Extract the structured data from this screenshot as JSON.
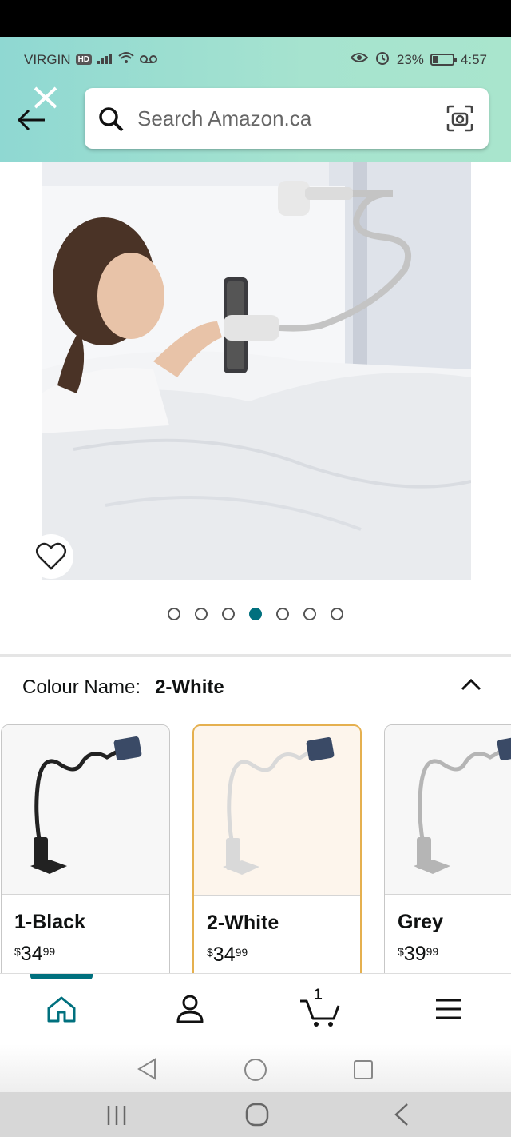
{
  "status_bar": {
    "carrier": "VIRGIN",
    "network_badge": "HD",
    "battery_percent": "23%",
    "battery_level": 0.23,
    "time": "4:57",
    "icons": [
      "signal-icon",
      "wifi-icon",
      "voicemail-icon",
      "eye-icon",
      "alarm-icon",
      "battery-icon"
    ]
  },
  "header": {
    "back_icon": "arrow-left-icon",
    "close_icon": "close-icon",
    "search": {
      "placeholder": "Search Amazon.ca",
      "value": "",
      "search_icon": "search-icon",
      "camera_icon": "camera-scan-icon"
    },
    "gradient_colors": [
      "#8fd8d2",
      "#a9e5cd"
    ]
  },
  "gallery": {
    "wishlist_icon": "heart-icon",
    "image_count": 7,
    "active_index": 3
  },
  "variation": {
    "label": "Colour Name:",
    "selected_value": "2-White",
    "toggle_icon": "chevron-up-icon",
    "options": [
      {
        "name": "1-Black",
        "currency": "$",
        "price_whole": "34",
        "price_cents": "99",
        "stand_color": "#222222",
        "selected": false
      },
      {
        "name": "2-White",
        "currency": "$",
        "price_whole": "34",
        "price_cents": "99",
        "stand_color": "#d9d9d9",
        "selected": true
      },
      {
        "name": "Grey",
        "currency": "$",
        "price_whole": "39",
        "price_cents": "99",
        "stand_color": "#b5b5b5",
        "selected": false
      }
    ]
  },
  "bottom_nav": {
    "items": [
      {
        "icon": "home-icon",
        "active": true
      },
      {
        "icon": "account-icon",
        "active": false
      },
      {
        "icon": "cart-icon",
        "active": false,
        "count": "1"
      },
      {
        "icon": "menu-icon",
        "active": false
      }
    ],
    "accent_color": "#00707e"
  },
  "system_nav": {
    "row1": [
      "back-triangle-icon",
      "home-circle-icon",
      "recents-square-icon"
    ],
    "row2": [
      "recents-lines-icon",
      "home-rounded-icon",
      "back-chevron-icon"
    ]
  }
}
